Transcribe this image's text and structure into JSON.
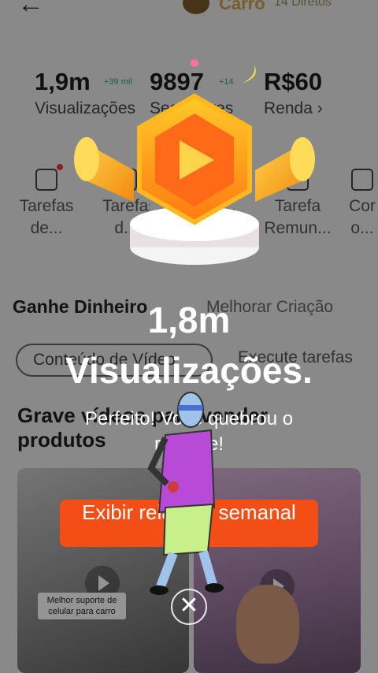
{
  "header": {
    "back_icon": "back-arrow-icon",
    "account_name": "Carro",
    "account_sub": "14 Diretos"
  },
  "stats": [
    {
      "value": "1,9m",
      "delta": "+39 mil",
      "label": "Visualizações"
    },
    {
      "value": "9897",
      "delta": "+14",
      "label": "Seguidores"
    },
    {
      "value": "R$60",
      "delta": "",
      "label": "Renda ›"
    }
  ],
  "tasks": [
    {
      "label": "Tarefas de..."
    },
    {
      "label": "Tarefas d..."
    },
    {
      "label": "Ta..."
    },
    {
      "label": "Tarefa Remun..."
    },
    {
      "label": "Cor o..."
    }
  ],
  "sections": {
    "earn_title": "Ganhe Dinheiro",
    "improve_title": "Melhorar Criação"
  },
  "chips": {
    "active": "Conteúdo de Vídeo",
    "other": "Execute tarefas"
  },
  "headline": "Grave vídeos para vender produtos",
  "video_caption": "Melhor suporte de celular para carro",
  "popup": {
    "big_value": "1,8m",
    "big_label": "Visualizações.",
    "message": "Perfeito! Você quebrou o recorde!",
    "cta_label": "Exibir relatório semanal",
    "close_icon": "close-icon",
    "badge_icon": "play-badge-icon"
  },
  "colors": {
    "accent": "#f24e16",
    "badge_orange": "#ff8a1a",
    "delta_green": "#2aa86b"
  }
}
